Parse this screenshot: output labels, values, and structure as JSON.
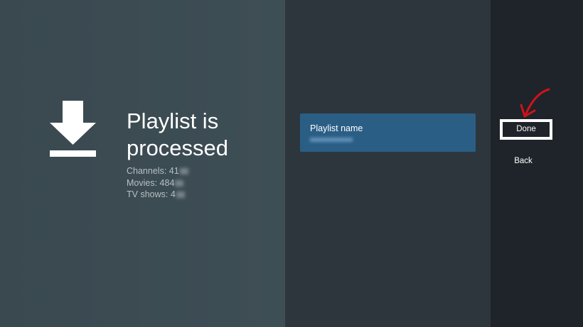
{
  "left": {
    "title": "Playlist is processed",
    "stats": [
      {
        "label": "Channels: 41"
      },
      {
        "label": "Movies: 484"
      },
      {
        "label": "TV shows: 4"
      }
    ]
  },
  "middle": {
    "playlist_label": "Playlist name"
  },
  "actions": {
    "done_label": "Done",
    "back_label": "Back"
  },
  "colors": {
    "accent_card": "#2b5e85",
    "annotation": "#d0121b"
  },
  "icons": {
    "main": "download-icon",
    "annotation": "red-arrow-annotation"
  }
}
